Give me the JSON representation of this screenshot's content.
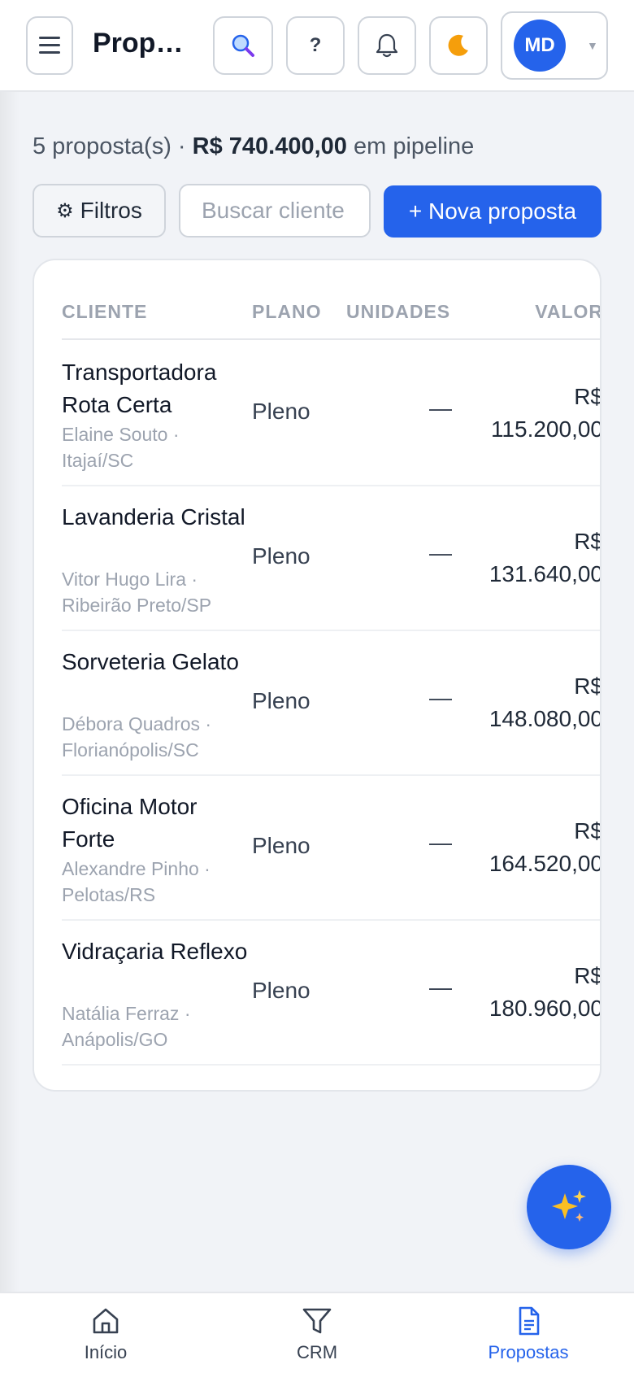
{
  "header": {
    "title": "Propostas",
    "user_initials": "MD",
    "help_label": "?"
  },
  "summary": {
    "count_text": "5 proposta(s) · ",
    "amount": "R$ 740.400,00",
    "suffix": " em pipeline"
  },
  "toolbar": {
    "filters_label": "Filtros",
    "search_placeholder": "Buscar cliente",
    "new_label": "+ Nova proposta"
  },
  "table": {
    "headers": {
      "cliente": "CLIENTE",
      "plano": "PLANO",
      "unidades": "UNIDADES",
      "valor": "VALOR"
    },
    "rows": [
      {
        "name": "Transportadora Rota Certa",
        "sub": "Elaine Souto · Itajaí/SC",
        "plano": "Pleno",
        "unidades": "—",
        "valor": "R$ 115.200,00"
      },
      {
        "name": "Lavanderia Cristal",
        "sub": "Vitor Hugo Lira · Ribeirão Preto/SP",
        "plano": "Pleno",
        "unidades": "—",
        "valor": "R$ 131.640,00"
      },
      {
        "name": "Sorveteria Gelato",
        "sub": "Débora Quadros · Florianópolis/SC",
        "plano": "Pleno",
        "unidades": "—",
        "valor": "R$ 148.080,00"
      },
      {
        "name": "Oficina Motor Forte",
        "sub": "Alexandre Pinho · Pelotas/RS",
        "plano": "Pleno",
        "unidades": "—",
        "valor": "R$ 164.520,00"
      },
      {
        "name": "Vidraçaria Reflexo",
        "sub": "Natália Ferraz · Anápolis/GO",
        "plano": "Pleno",
        "unidades": "—",
        "valor": "R$ 180.960,00"
      }
    ]
  },
  "nav": {
    "inicio": "Início",
    "crm": "CRM",
    "propostas": "Propostas"
  },
  "colors": {
    "accent": "#2563eb",
    "muted_text": "#9ca3af"
  },
  "icons": [
    "menu-icon",
    "search-icon",
    "help-icon",
    "bell-icon",
    "moon-icon",
    "chevron-down-icon",
    "gear-icon",
    "sparkles-icon",
    "home-icon",
    "funnel-icon",
    "document-icon"
  ]
}
